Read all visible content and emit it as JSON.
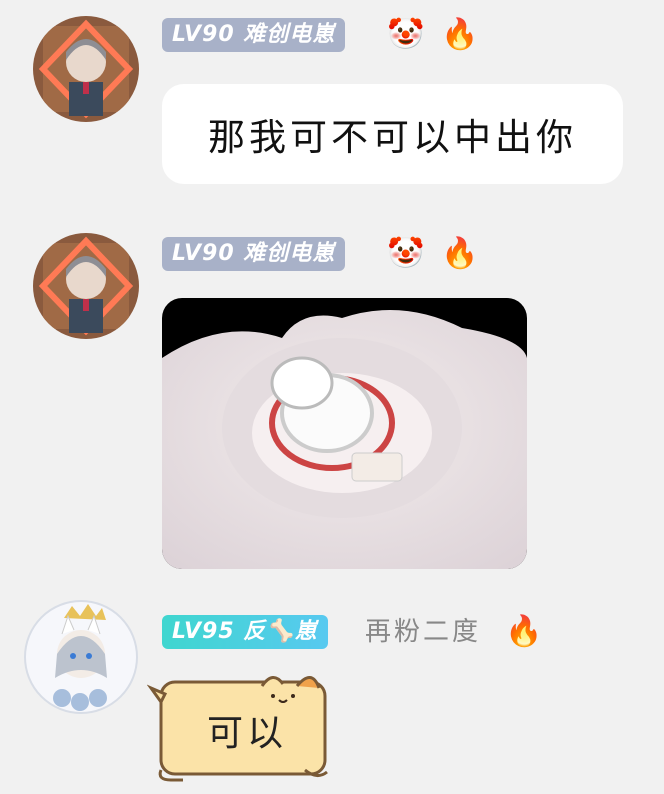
{
  "messages": [
    {
      "badge": "LV90 难创电崽",
      "emoji1": "🤡",
      "emoji2": "🔥",
      "text": "那我可不可以中出你"
    },
    {
      "badge": "LV90 难创电崽",
      "emoji1": "🤡",
      "emoji2": "🔥",
      "image": "sticker-photo"
    },
    {
      "badge": "LV95 反🦴崽",
      "title": "再粉二度",
      "emoji1": "🔥",
      "text": "可以"
    }
  ],
  "colors": {
    "background": "#f1f1f1",
    "badge_grey": "#a8b1c8",
    "badge_teal": "#3fd6cf",
    "cat_bubble": "#fbe3a8"
  }
}
